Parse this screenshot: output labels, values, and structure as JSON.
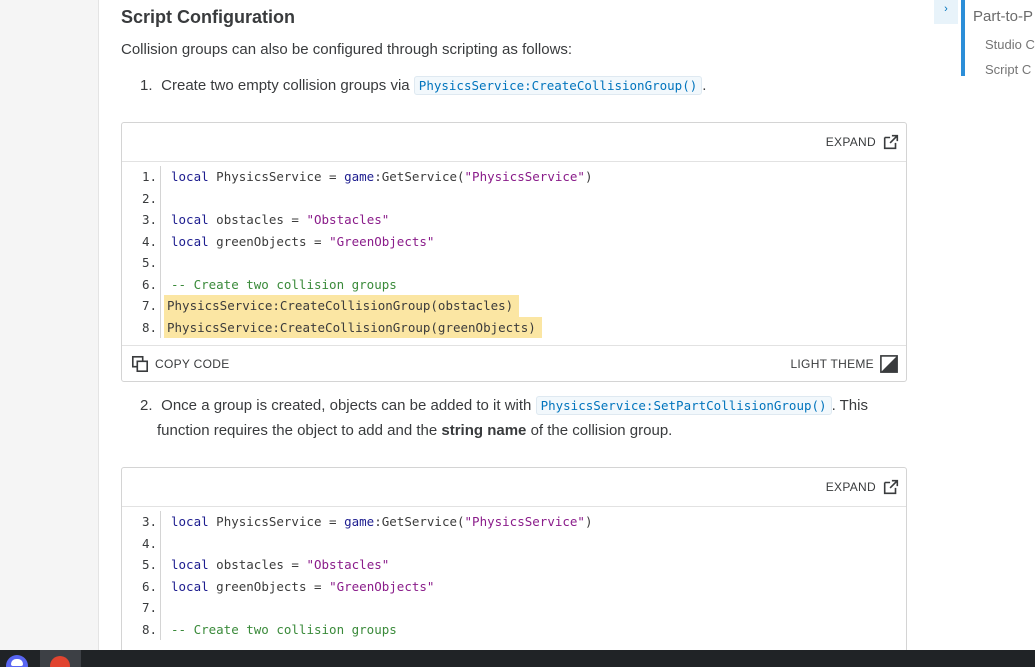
{
  "section": {
    "title": "Script Configuration",
    "intro": "Collision groups can also be configured through scripting as follows:"
  },
  "steps": [
    {
      "num": "1.",
      "before": "Create two empty collision groups via",
      "code": "PhysicsService:CreateCollisionGroup()",
      "after": "."
    },
    {
      "num": "2.",
      "before": "Once a group is created, objects can be added to it with",
      "code": "PhysicsService:SetPartCollisionGroup()",
      "after": ". This",
      "line2_before": "function requires the object to add and the",
      "line2_bold": "string name",
      "line2_after": "of the collision group."
    }
  ],
  "codebox": {
    "expand_label": "EXPAND",
    "copy_label": "COPY CODE",
    "theme_label": "LIGHT THEME"
  },
  "code1": {
    "line_numbers": [
      "1.",
      "2.",
      "3.",
      "4.",
      "5.",
      "6.",
      "7.",
      "8."
    ],
    "l1": {
      "kw": "local",
      "id": " PhysicsService = ",
      "kw2": "game",
      "id2": ":GetService(",
      "str": "\"PhysicsService\"",
      "end": ")"
    },
    "l3": {
      "kw": "local",
      "id": " obstacles = ",
      "str": "\"Obstacles\""
    },
    "l4": {
      "kw": "local",
      "id": " greenObjects = ",
      "str": "\"GreenObjects\""
    },
    "l6": "-- Create two collision groups",
    "l7": "PhysicsService:CreateCollisionGroup(obstacles)",
    "l8": "PhysicsService:CreateCollisionGroup(greenObjects)"
  },
  "code2": {
    "line_numbers": [
      "3.",
      "4.",
      "5.",
      "6.",
      "7.",
      "8."
    ],
    "l3": {
      "kw": "local",
      "id": " PhysicsService = ",
      "kw2": "game",
      "id2": ":GetService(",
      "str": "\"PhysicsService\"",
      "end": ")"
    },
    "l5": {
      "kw": "local",
      "id": " obstacles = ",
      "str": "\"Obstacles\""
    },
    "l6": {
      "kw": "local",
      "id": " greenObjects = ",
      "str": "\"GreenObjects\""
    },
    "l8": "-- Create two collision groups"
  },
  "toc": {
    "toggle": "›",
    "title": "Part-to-P",
    "items": [
      "Studio C",
      "Script C"
    ]
  },
  "colors": {
    "link_blue": "#0074bd",
    "highlight": "#fbe6a3",
    "toc_bar": "#2b8ed8"
  },
  "icons": {
    "expand": "external-link-icon",
    "copy": "copy-icon",
    "theme": "theme-toggle-icon"
  }
}
